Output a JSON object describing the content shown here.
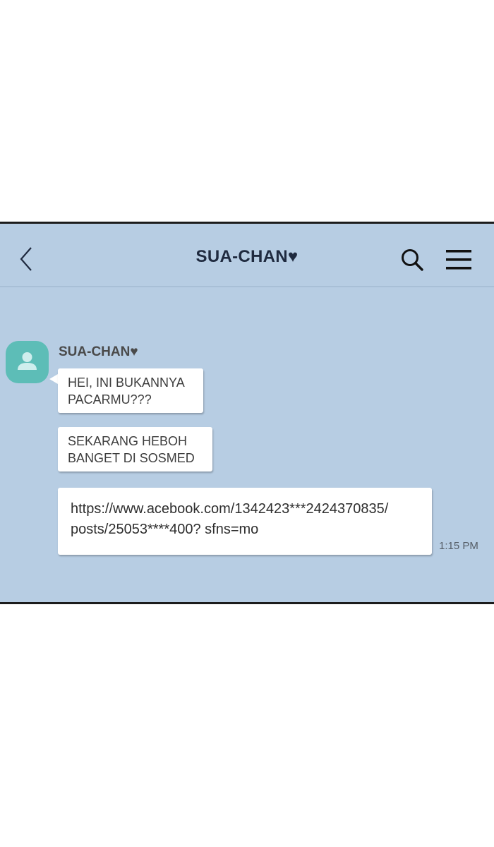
{
  "header": {
    "title": "SUA-CHAN♥",
    "back_icon": "chevron-left-icon",
    "search_icon": "search-icon",
    "menu_icon": "hamburger-menu-icon"
  },
  "conversation": {
    "sender_name": "SUA-CHAN♥",
    "avatar_icon": "person-icon",
    "messages": [
      {
        "text": "HEI, INI BUKANNYA\nPACARMU???"
      },
      {
        "text": "SEKARANG HEBOH\nBANGET DI SOSMED"
      },
      {
        "text": "https://www.acebook.com/1342423***2424370835/\nposts/25053****400? sfns=mo",
        "time": "1:15 PM"
      }
    ]
  },
  "colors": {
    "chat_background": "#b7cde3",
    "avatar": "#5dbdb7",
    "bubble": "#ffffff",
    "title_text": "#1f2a3f"
  }
}
